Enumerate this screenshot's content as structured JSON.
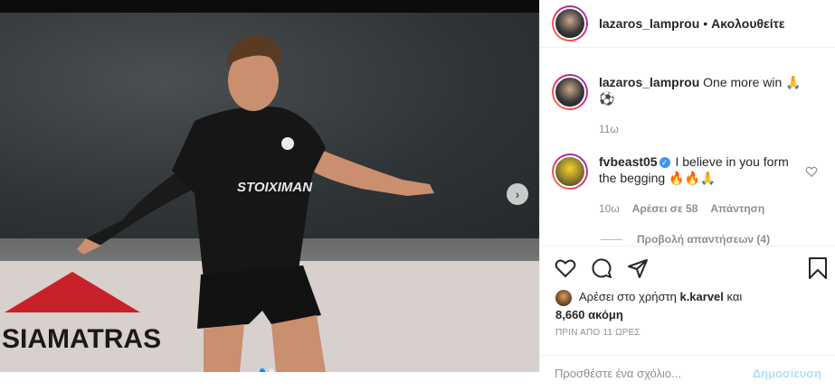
{
  "header": {
    "username": "lazaros_lamprou",
    "separator": "•",
    "follow_label": "Ακολουθείτε"
  },
  "photo": {
    "banner_text": "SIAMATRAS",
    "jersey_text": "STOIXIMAN"
  },
  "caption": {
    "username": "lazaros_lamprou",
    "text": "One more win 🙏",
    "emoji_line": "⚽",
    "time": "11ω"
  },
  "comment": {
    "username": "fvbeast05",
    "verified": "✓",
    "text": "I believe in you form the begging 🔥🔥🙏",
    "time": "10ω",
    "likes": "Αρέσει σε 58",
    "reply": "Απάντηση"
  },
  "replies": {
    "label": "Προβολή απαντήσεων (4)"
  },
  "likes": {
    "prefix": "Αρέσει στο χρήστη",
    "user": "k.karvel",
    "and": "και",
    "count": "8,660 ακόμη"
  },
  "timestamp": "ΠΡΙΝ ΑΠΟ 11 ΩΡΕΣ",
  "add_comment": {
    "placeholder": "Προσθέστε ένα σχόλιο...",
    "post_label": "Δημοσίευση"
  },
  "carousel": {
    "next_icon": "›",
    "total": 2,
    "active": 1
  },
  "colors": {
    "accent": "#0095f6",
    "verified": "#3897f0",
    "muted": "#8e8e8e"
  }
}
